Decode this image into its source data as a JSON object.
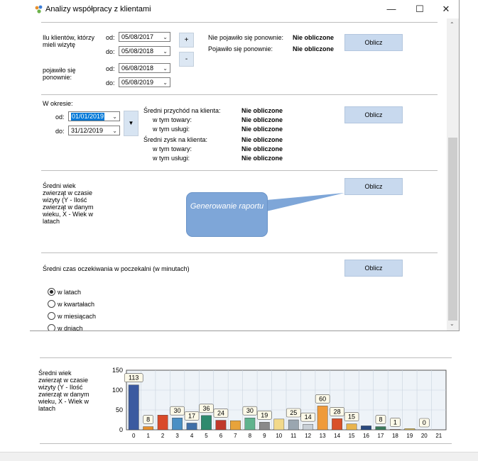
{
  "window": {
    "title": "Analizy współpracy z klientami",
    "minimize": "—",
    "maximize": "☐",
    "close": "✕"
  },
  "section1": {
    "label": "Ilu klientów, którzy mieli wizytę",
    "from_label": "od:",
    "to_label": "do:",
    "from_value": "05/08/2017",
    "to_value": "05/08/2018",
    "plus": "+",
    "minus": "-",
    "label2": "pojawiło się ponownie:",
    "from2_value": "06/08/2018",
    "to2_value": "05/08/2019",
    "not_returned_label": "Nie pojawiło się ponownie:",
    "not_returned_value": "Nie obliczone",
    "returned_label": "Pojawiło się ponownie:",
    "returned_value": "Nie obliczone",
    "calc": "Oblicz"
  },
  "section2": {
    "period_label": "W okresie:",
    "from_label": "od:",
    "to_label": "do:",
    "from_value": "01/01/2019",
    "to_value": "31/12/2019",
    "revenue_label": "Średni przychód na klienta:",
    "revenue_value": "Nie obliczone",
    "goods_label": "w tym towary:",
    "goods_value": "Nie obliczone",
    "services_label": "w tym usługi:",
    "services_value": "Nie obliczone",
    "profit_label": "Średni zysk na klienta:",
    "profit_value": "Nie obliczone",
    "profit_goods_label": "w tym towary:",
    "profit_goods_value": "Nie obliczone",
    "profit_services_label": "w tym usługi:",
    "profit_services_value": "Nie obliczone",
    "calc": "Oblicz"
  },
  "section3": {
    "label": "Średni wiek zwierząt w czasie wizyty (Y - Ilość zwierząt w danym wieku, X - Wiek w latach",
    "calc": "Oblicz",
    "tooltip": "Generowanie raportu"
  },
  "section4": {
    "label": "Średni czas oczekiwania w poczekalni (w minutach)",
    "calc": "Oblicz",
    "options": [
      "w latach",
      "w kwartałach",
      "w miesiącach",
      "w dniach"
    ],
    "selected": 0
  },
  "bottom": {
    "label": "Średni wiek zwierząt w czasie wizyty (Y - Ilość zwierząt w danym wieku, X - Wiek w latach"
  },
  "chart_data": {
    "type": "bar",
    "categories": [
      "0",
      "1",
      "2",
      "3",
      "4",
      "5",
      "6",
      "7",
      "8",
      "9",
      "10",
      "11",
      "12",
      "13",
      "14",
      "15",
      "16",
      "17",
      "18",
      "19",
      "20",
      "21"
    ],
    "values": [
      113,
      8,
      37,
      30,
      17,
      36,
      24,
      23,
      30,
      19,
      27,
      25,
      14,
      60,
      28,
      15,
      10,
      8,
      1,
      3,
      0,
      0
    ],
    "data_labels": [
      113,
      8,
      null,
      30,
      17,
      36,
      24,
      null,
      30,
      19,
      null,
      25,
      14,
      60,
      28,
      15,
      null,
      8,
      1,
      null,
      0,
      null
    ],
    "colors": [
      "#3b5aa0",
      "#e8902c",
      "#d94a2a",
      "#4a8fc4",
      "#3f6fa8",
      "#2e8a6e",
      "#c0392b",
      "#e8a33a",
      "#5fb38e",
      "#8a8a8a",
      "#f2d98a",
      "#9aa6b0",
      "#c9d0d6",
      "#ef9a3a",
      "#d9502a",
      "#e9b44c",
      "#2a4a80",
      "#3a7a5a",
      "#c07040",
      "#e0c060",
      "#a0b0c0",
      "#7090a0"
    ],
    "ylim": [
      0,
      150
    ],
    "yticks": [
      0,
      50,
      100,
      150
    ],
    "grid": true
  }
}
